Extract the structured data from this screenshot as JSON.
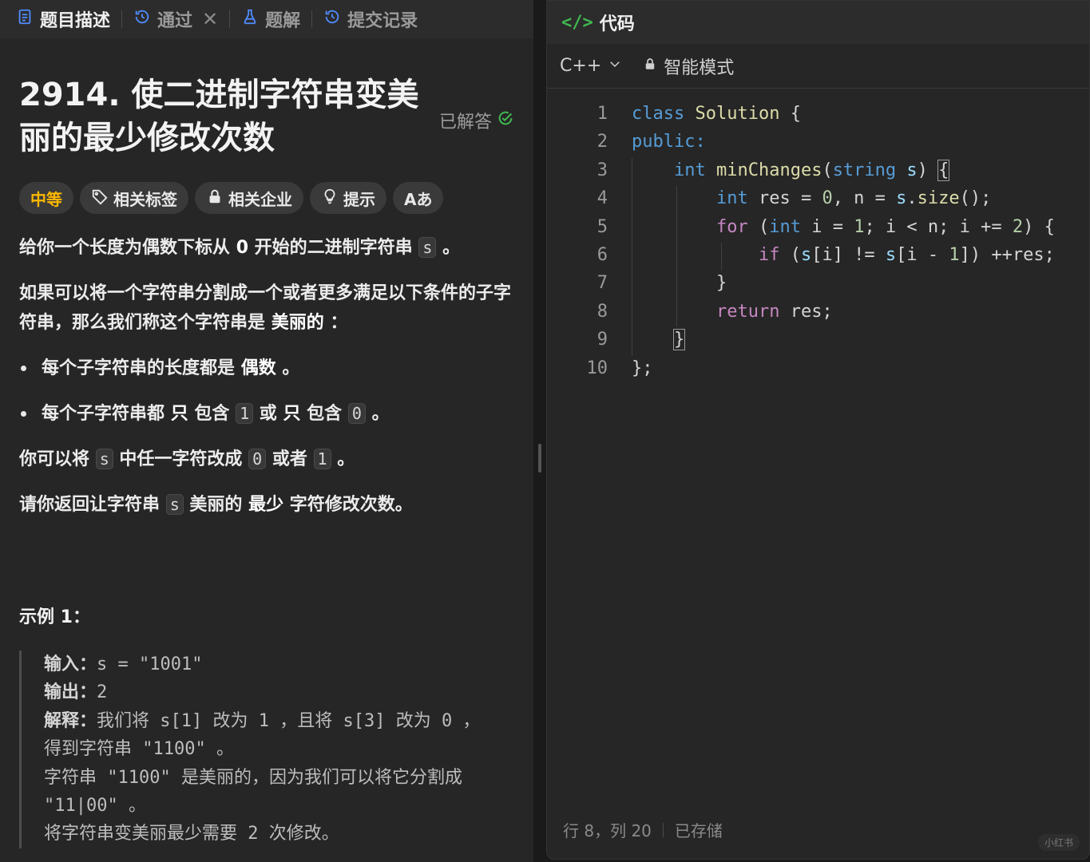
{
  "left_tabs": [
    {
      "label": "题目描述",
      "icon": "document-icon",
      "active": true
    },
    {
      "label": "通过",
      "icon": "history-icon",
      "active": false,
      "closable": true
    },
    {
      "label": "题解",
      "icon": "flask-icon",
      "active": false
    },
    {
      "label": "提交记录",
      "icon": "history-icon",
      "active": false
    }
  ],
  "problem": {
    "title": "2914. 使二进制字符串变美丽的最少修改次数",
    "solved_label": "已解答",
    "difficulty": "中等",
    "badges": [
      "相关标签",
      "相关企业",
      "提示",
      "Aあ"
    ],
    "desc": {
      "p1_a": "给你一个长度为偶数下标从",
      "p1_zero": "0",
      "p1_b": "开始的二进制字符串",
      "p1_code": "s",
      "p1_c": "。",
      "p2_a": "如果可以将一个字符串分割成一个或者更多满足以下条件的子字符串，那么我们称这个字符串是",
      "p2_strong": "美丽的",
      "p2_b": "：",
      "li1_a": "每个子字符串的长度都是",
      "li1_strong": "偶数",
      "li1_b": "。",
      "li2_a": "每个子字符串都",
      "li2_only": "只",
      "li2_b": "包含",
      "li2_code1": "1",
      "li2_or": "或",
      "li2_only2": "只",
      "li2_c": "包含",
      "li2_code0": "0",
      "li2_d": "。",
      "p3_a": "你可以将",
      "p3_code": "s",
      "p3_b": "中任一字符改成",
      "p3_code0": "0",
      "p3_c": "或者",
      "p3_code1": "1",
      "p3_d": "。",
      "p4_a": "请你返回让字符串",
      "p4_code": "s",
      "p4_b": "美丽的",
      "p4_strong": "最少",
      "p4_c": "字符修改次数。"
    },
    "example_title": "示例 1：",
    "example": {
      "input_label": "输入：",
      "input_value": "s = \"1001\"",
      "output_label": "输出：",
      "output_value": "2",
      "explain_label": "解释：",
      "explain_1": "我们将 s[1] 改为 1 ，且将 s[3] 改为 0 ，",
      "explain_2": "得到字符串 \"1100\" 。",
      "explain_3": "字符串 \"1100\" 是美丽的，因为我们可以将它分割成",
      "explain_4": "\"11|00\" 。",
      "explain_5": "将字符串变美丽最少需要 2 次修改。"
    }
  },
  "editor": {
    "header": "代码",
    "language": "C++",
    "mode": "智能模式",
    "status_position": "行 8，列 20",
    "status_saved": "已存储"
  },
  "watermark": "小红书",
  "colors": {
    "accent_green": "#3fb950",
    "difficulty": "#ffb800",
    "keyword": "#569cd6",
    "control": "#c586c0"
  }
}
